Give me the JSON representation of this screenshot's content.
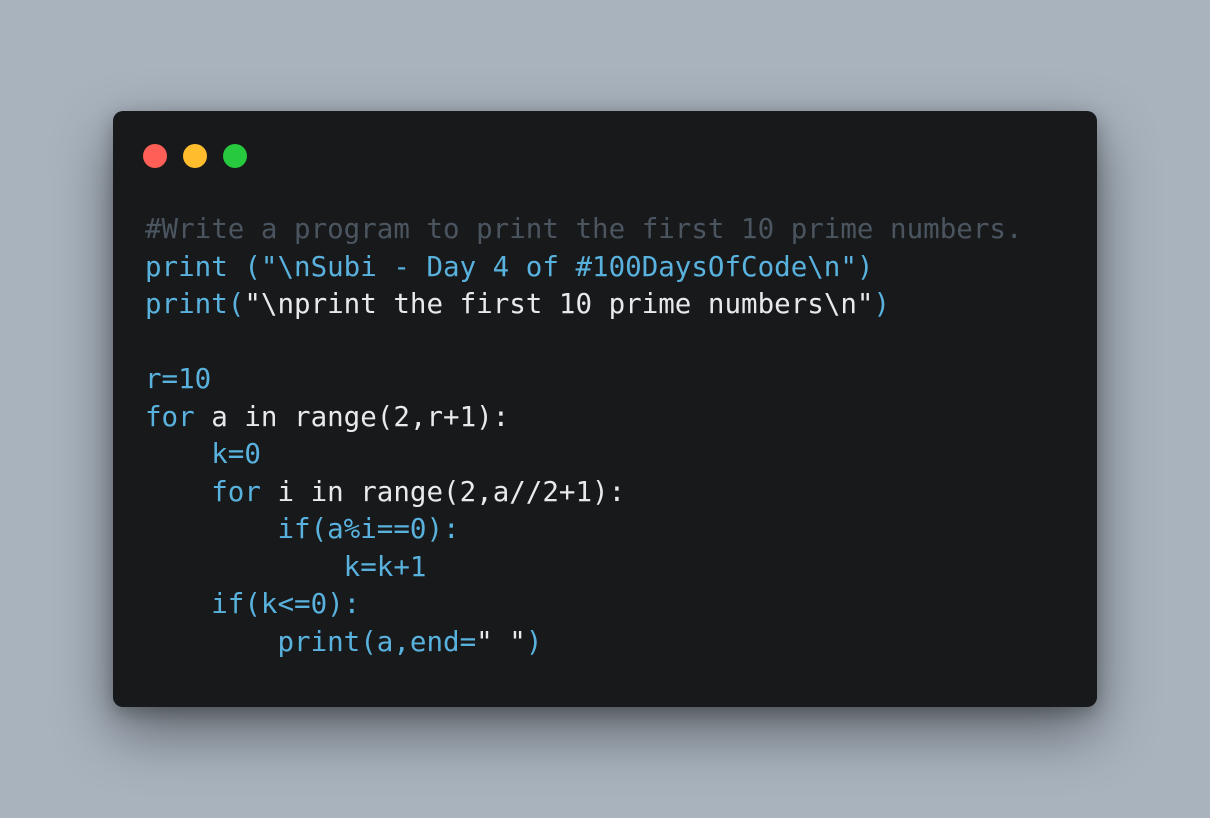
{
  "window": {
    "controls": [
      {
        "name": "close",
        "color": "#ff5f56"
      },
      {
        "name": "minimize",
        "color": "#ffbd2e"
      },
      {
        "name": "maximize",
        "color": "#27c93f"
      }
    ]
  },
  "code": {
    "lines": [
      {
        "tokens": [
          {
            "text": "#Write a program to print the first 10 prime numbers.",
            "kind": "comment"
          }
        ]
      },
      {
        "tokens": [
          {
            "text": "print (\"\\nSubi - Day 4 of #100DaysOfCode\\n\")",
            "kind": "blue"
          }
        ]
      },
      {
        "tokens": [
          {
            "text": "print(",
            "kind": "blue"
          },
          {
            "text": "\"\\nprint the first 10 prime numbers\\n\"",
            "kind": "white"
          },
          {
            "text": ")",
            "kind": "blue"
          }
        ]
      },
      {
        "tokens": []
      },
      {
        "tokens": [
          {
            "text": "r=10",
            "kind": "blue"
          }
        ]
      },
      {
        "tokens": [
          {
            "text": "for",
            "kind": "blue"
          },
          {
            "text": " a in range(2,r+1):",
            "kind": "white"
          }
        ]
      },
      {
        "tokens": [
          {
            "text": "    k=0",
            "kind": "blue"
          }
        ]
      },
      {
        "tokens": [
          {
            "text": "    for",
            "kind": "blue"
          },
          {
            "text": " i in range(2,a//2+1):",
            "kind": "white"
          }
        ]
      },
      {
        "tokens": [
          {
            "text": "        if(a%i==0):",
            "kind": "blue"
          }
        ]
      },
      {
        "tokens": [
          {
            "text": "            k=k+1",
            "kind": "blue"
          }
        ]
      },
      {
        "tokens": [
          {
            "text": "    if(k<=0):",
            "kind": "blue"
          }
        ]
      },
      {
        "tokens": [
          {
            "text": "        print(a,end=",
            "kind": "blue"
          },
          {
            "text": "\" \"",
            "kind": "white"
          },
          {
            "text": ")",
            "kind": "blue"
          }
        ]
      }
    ]
  },
  "colors": {
    "background": "#a9b3be",
    "editor": "#18191b",
    "comment": "#4b5560",
    "keyword_blue": "#59b2de",
    "text_white": "#e7e9ec"
  }
}
